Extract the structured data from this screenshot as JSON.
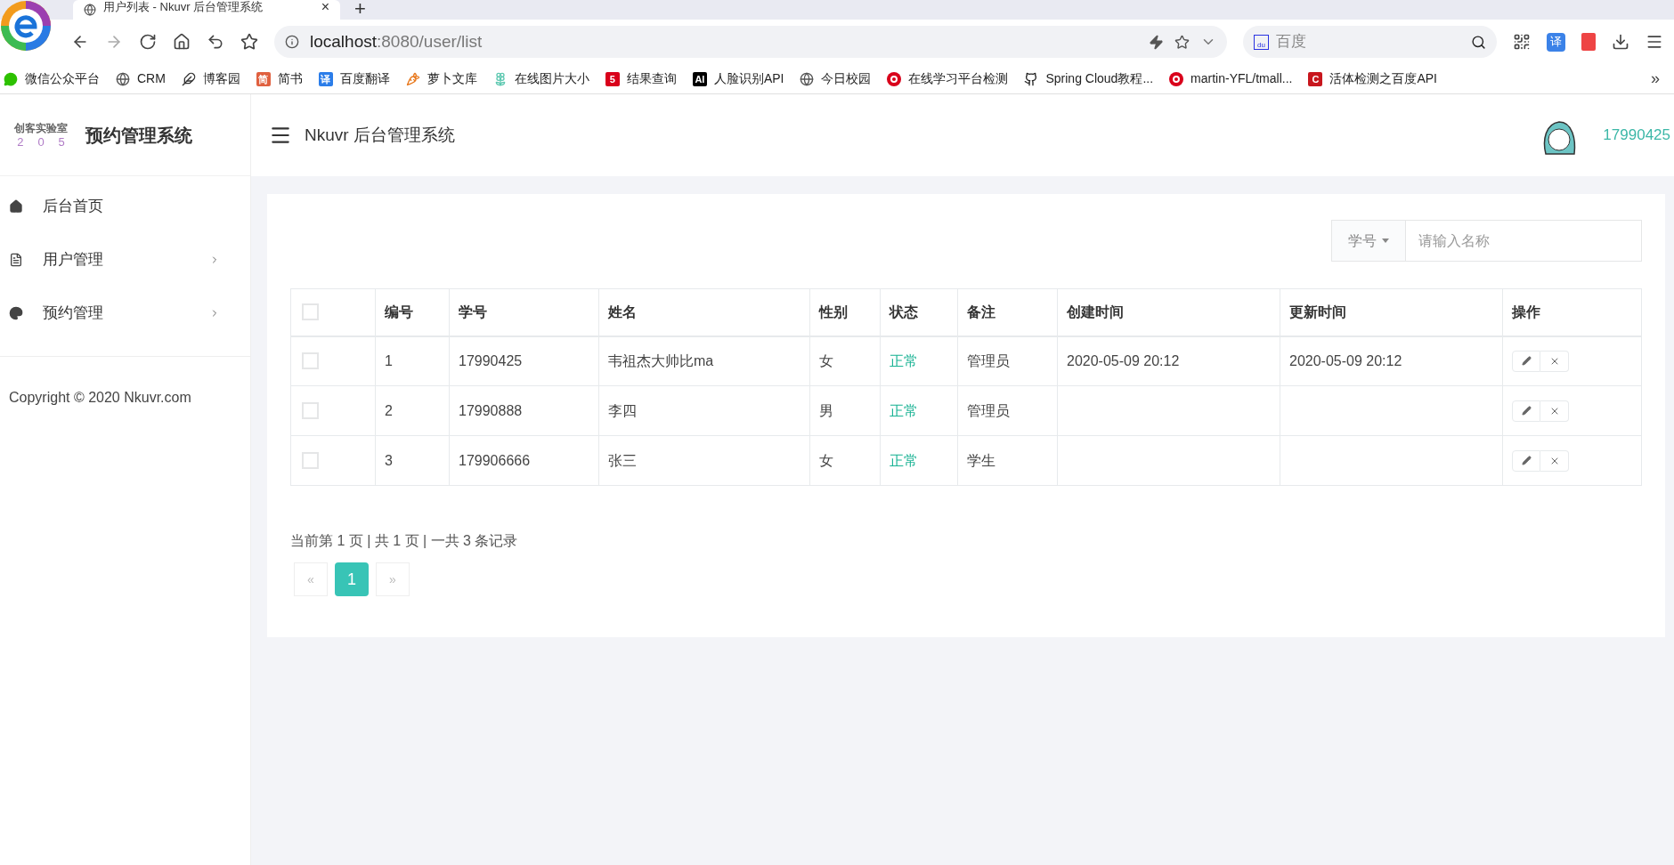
{
  "browser": {
    "tab_title": "用户列表 - Nkuvr 后台管理系统",
    "tab_close": "×",
    "new_tab": "+",
    "url_host": "localhost",
    "url_rest": ":8080/user/list",
    "search_placeholder": "百度",
    "search_badge": "du",
    "translate_badge": "译",
    "bookmarks": [
      {
        "label": "微信公众平台",
        "kind": "wechat"
      },
      {
        "label": "CRM",
        "kind": "globe"
      },
      {
        "label": "博客园",
        "kind": "blog"
      },
      {
        "label": "简书",
        "kind": "badge",
        "badge": "简",
        "color": "#e0603f"
      },
      {
        "label": "百度翻译",
        "kind": "badge",
        "badge": "译",
        "color": "#2b7de9"
      },
      {
        "label": "萝卜文库",
        "kind": "carrot"
      },
      {
        "label": "在线图片大小",
        "kind": "flower"
      },
      {
        "label": "结果查询",
        "kind": "badge",
        "badge": "5",
        "color": "#d9001b"
      },
      {
        "label": "人脸识别API",
        "kind": "badge",
        "badge": "AI",
        "color": "#000000"
      },
      {
        "label": "今日校园",
        "kind": "globe"
      },
      {
        "label": "在线学习平台检测",
        "kind": "gicon"
      },
      {
        "label": "Spring Cloud教程...",
        "kind": "github"
      },
      {
        "label": "martin-YFL/tmall...",
        "kind": "gicon"
      },
      {
        "label": "活体检测之百度API",
        "kind": "badge",
        "badge": "C",
        "color": "#c8161d"
      }
    ],
    "more": "»"
  },
  "app": {
    "logo_top": "创客实验室",
    "logo_digits": [
      "2",
      "0",
      "5"
    ],
    "brand": "预约管理系统",
    "header_title": "Nkuvr 后台管理系统",
    "user": "17990425"
  },
  "sidebar": {
    "items": [
      {
        "label": "后台首页",
        "kind": "home",
        "expandable": false
      },
      {
        "label": "用户管理",
        "kind": "file",
        "expandable": true
      },
      {
        "label": "预约管理",
        "kind": "palette",
        "expandable": true
      }
    ],
    "copyright": "Copyright © 2020 Nkuvr.com"
  },
  "search": {
    "field_label": "学号",
    "placeholder": "请输入名称"
  },
  "table": {
    "all_checked": false,
    "columns": [
      "编号",
      "学号",
      "姓名",
      "性别",
      "状态",
      "备注",
      "创建时间",
      "更新时间",
      "操作"
    ],
    "rows": [
      {
        "checked": false,
        "cells": [
          "1",
          "17990425",
          "韦祖杰大帅比ma",
          "女",
          "正常",
          "管理员",
          "2020-05-09 20:12",
          "2020-05-09 20:12"
        ]
      },
      {
        "checked": false,
        "cells": [
          "2",
          "17990888",
          "李四",
          "男",
          "正常",
          "管理员",
          "",
          ""
        ]
      },
      {
        "checked": false,
        "cells": [
          "3",
          "179906666",
          "张三",
          "女",
          "正常",
          "学生",
          "",
          ""
        ]
      }
    ]
  },
  "pagination": {
    "summary": "当前第 1 页 | 共 1 页 | 一共 3 条记录",
    "prev": "«",
    "next": "»",
    "pages": [
      {
        "label": "1",
        "selected": true
      }
    ]
  }
}
